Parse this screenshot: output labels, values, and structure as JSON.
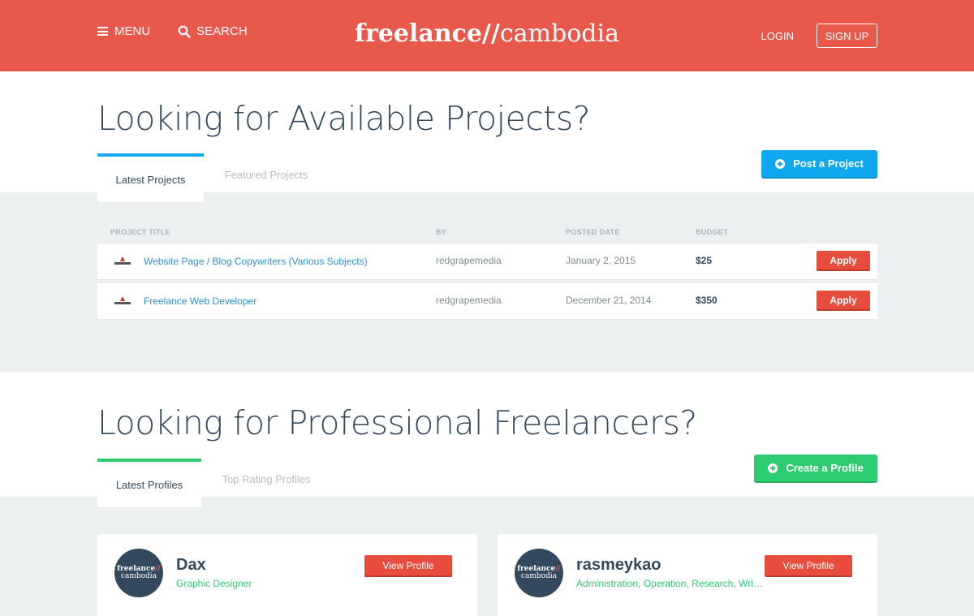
{
  "header": {
    "menu_label": "MENU",
    "search_label": "SEARCH",
    "logo_bold": "freelance//",
    "logo_light": "cambodia",
    "login_label": "LOGIN",
    "signup_label": "SIGN UP",
    "bg_color": "#e9594b"
  },
  "projects": {
    "title": "Looking for Available Projects?",
    "tabs": [
      {
        "label": "Latest Projects",
        "active": true
      },
      {
        "label": "Featured Projects",
        "active": false
      }
    ],
    "tab_accent": "#17a9ef",
    "post_button": "Post a Project",
    "columns": [
      "PROJECT TITLE",
      "BY",
      "POSTED DATE",
      "BUDGET"
    ],
    "rows": [
      {
        "title": "Website Page / Blog Copywriters (Various Subjects)",
        "by": "redgrapemedia",
        "date": "January 2, 2015",
        "budget": "$25",
        "action": "Apply"
      },
      {
        "title": "Freelance Web Developer",
        "by": "redgrapemedia",
        "date": "December 21, 2014",
        "budget": "$350",
        "action": "Apply"
      }
    ]
  },
  "freelancers": {
    "title": "Looking for Professional Freelancers?",
    "tabs": [
      {
        "label": "Latest Profiles",
        "active": true
      },
      {
        "label": "Top Rating Profiles",
        "active": false
      }
    ],
    "tab_accent": "#2ecc71",
    "create_button": "Create a Profile",
    "avatar_text": {
      "line1": "freelance",
      "slashes": "//",
      "line2": "cambodia"
    },
    "profiles": [
      {
        "name": "Dax",
        "role": "Graphic Designer",
        "button": "View Profile"
      },
      {
        "name": "rasmeykao",
        "role": "Administration, Operation, Research, Writing",
        "button": "View Profile"
      }
    ]
  },
  "colors": {
    "link_blue": "#2f8fd6",
    "apply_red": "#e74c3c",
    "post_blue": "#0fa8ef",
    "create_green": "#2ecc71",
    "band_gray": "#ecf0f1"
  },
  "icons": {
    "menu": "hamburger-icon",
    "search": "search-icon",
    "plus": "plus-circle-icon",
    "project_thumb": "redgrape-logo-icon"
  }
}
